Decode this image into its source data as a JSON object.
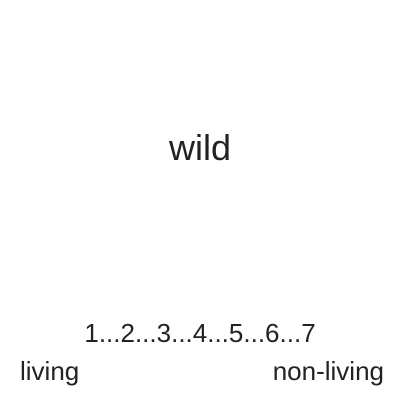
{
  "stimulus": {
    "word": "wild"
  },
  "scale": {
    "points": [
      "1",
      "2",
      "3",
      "4",
      "5",
      "6",
      "7"
    ],
    "separator": " ... ",
    "left_anchor": "living",
    "right_anchor": "non-living"
  }
}
